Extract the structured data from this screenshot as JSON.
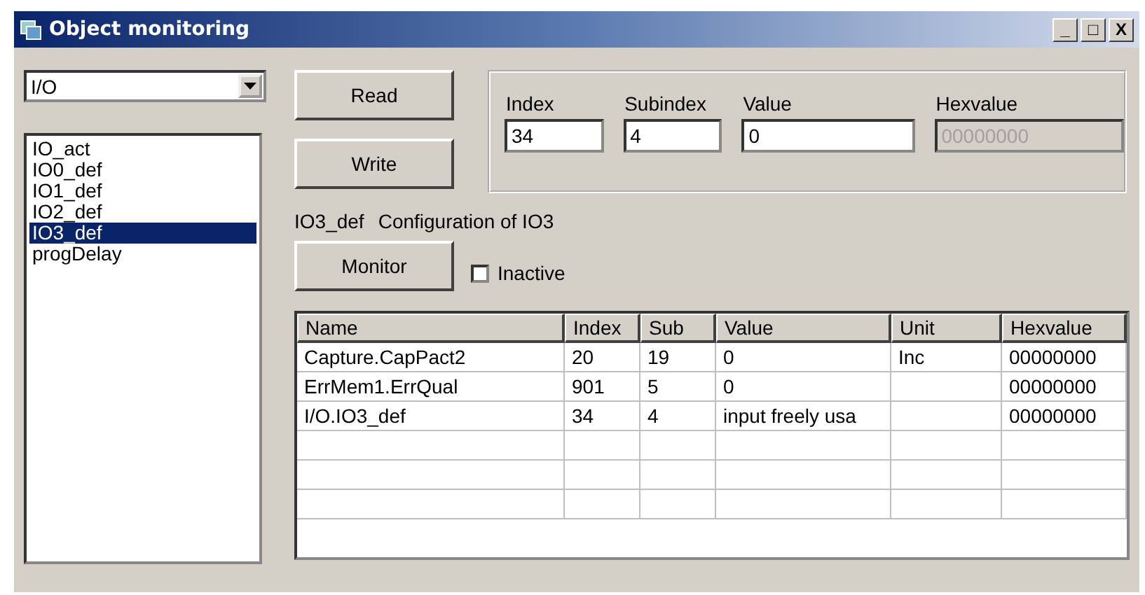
{
  "window": {
    "title": "Object monitoring",
    "controls": [
      "_",
      "□",
      "X"
    ]
  },
  "category": {
    "value": "I/O"
  },
  "objects": [
    {
      "label": "IO_act",
      "selected": false
    },
    {
      "label": "IO0_def",
      "selected": false
    },
    {
      "label": "IO1_def",
      "selected": false
    },
    {
      "label": "IO2_def",
      "selected": false
    },
    {
      "label": "IO3_def",
      "selected": true
    },
    {
      "label": "progDelay",
      "selected": false
    }
  ],
  "buttons": {
    "read": "Read",
    "write": "Write",
    "monitor": "Monitor"
  },
  "fields": [
    {
      "label": "Index",
      "value": "34",
      "disabled": false
    },
    {
      "label": "Subindex",
      "value": "4",
      "disabled": false
    },
    {
      "label": "Value",
      "value": "0",
      "disabled": false
    },
    {
      "label": "Hexvalue",
      "value": "00000000",
      "disabled": true
    }
  ],
  "description": {
    "name": "IO3_def",
    "text": "Configuration of IO3"
  },
  "inactive": {
    "label": "Inactive",
    "checked": false
  },
  "table": {
    "columns": [
      "Name",
      "Index",
      "Sub",
      "Value",
      "Unit",
      "Hexvalue"
    ],
    "rows": [
      [
        "Capture.CapPact2",
        "20",
        "19",
        "0",
        "Inc",
        "00000000"
      ],
      [
        "ErrMem1.ErrQual",
        "901",
        "5",
        "0",
        "",
        "00000000"
      ],
      [
        "I/O.IO3_def",
        "34",
        "4",
        "input freely usa",
        "",
        "00000000"
      ]
    ]
  }
}
